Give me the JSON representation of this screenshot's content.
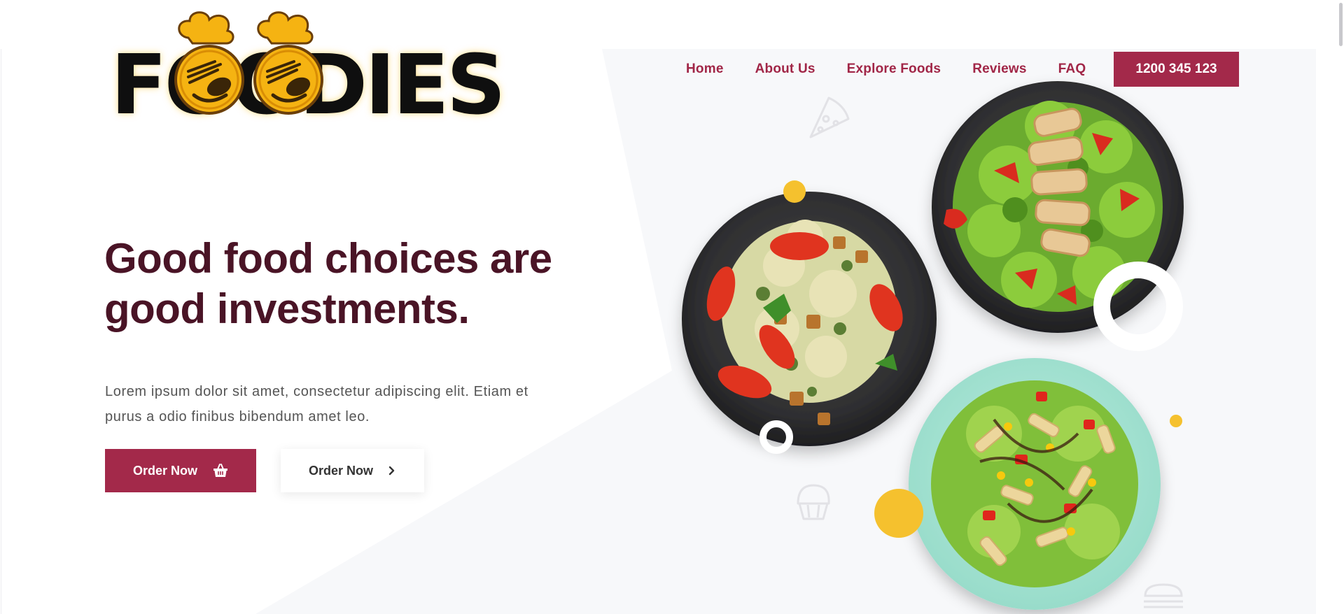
{
  "brand": {
    "logo_text": "FOODIES",
    "logo_colors": {
      "letters": "#0f0f0f",
      "mascot": "#f5b312",
      "outline": "#6b3f0a"
    }
  },
  "nav": {
    "items": [
      {
        "label": "Home"
      },
      {
        "label": "About Us"
      },
      {
        "label": "Explore Foods"
      },
      {
        "label": "Reviews"
      },
      {
        "label": "FAQ"
      }
    ],
    "phone_button": "1200 345 123"
  },
  "hero": {
    "headline_line1": "Good food choices are",
    "headline_line2": "good investments.",
    "body_line1": "Lorem ipsum dolor sit amet, consectetur adipiscing elit. Etiam et",
    "body_line2": "purus a odio finibus bibendum amet leo.",
    "primary_button": {
      "label": "Order Now",
      "icon": "basket-icon"
    },
    "secondary_button": {
      "label": "Order Now",
      "icon": "chevron-right-icon"
    }
  },
  "images": [
    {
      "name": "egg-salad-plate",
      "plate": "dark"
    },
    {
      "name": "chicken-salad-plate",
      "plate": "dark"
    },
    {
      "name": "pasta-salad-plate",
      "plate": "mint"
    }
  ],
  "decorations": {
    "icons": [
      "pizza-icon",
      "cupcake-icon",
      "burger-icon"
    ]
  },
  "colors": {
    "accent": "#a3294a",
    "headline": "#4a1426",
    "yellow": "#f5c12e",
    "panel": "#f7f8fa"
  }
}
